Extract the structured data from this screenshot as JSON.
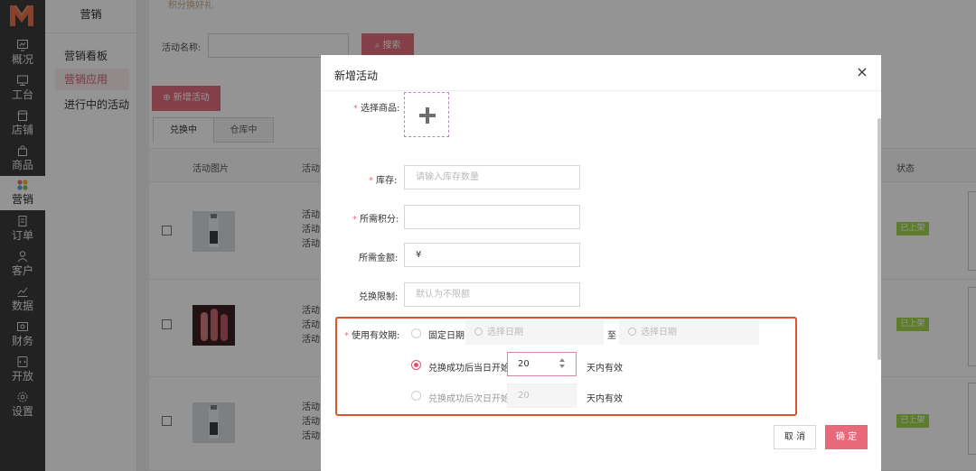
{
  "rail": {
    "items": [
      {
        "label": "概况",
        "icon": "chart-icon"
      },
      {
        "label": "工台",
        "icon": "monitor-icon"
      },
      {
        "label": "店铺",
        "icon": "shop-icon"
      },
      {
        "label": "商品",
        "icon": "bag-icon"
      },
      {
        "label": "营销",
        "icon": "marketing-icon"
      },
      {
        "label": "订单",
        "icon": "order-icon"
      },
      {
        "label": "客户",
        "icon": "user-icon"
      },
      {
        "label": "数据",
        "icon": "data-icon"
      },
      {
        "label": "财务",
        "icon": "finance-icon"
      },
      {
        "label": "开放",
        "icon": "api-icon"
      },
      {
        "label": "设置",
        "icon": "gear-icon"
      }
    ],
    "active": "营销",
    "logo_color": "#e8734e"
  },
  "sidebar": {
    "title": "营销",
    "items": [
      "营销看板",
      "营销应用",
      "进行中的活动"
    ],
    "active": "营销应用"
  },
  "main": {
    "breadcrumb": "积分换好礼",
    "filter": {
      "label": "活动名称:",
      "value": ""
    },
    "search_button": "搜索",
    "add_button": "新增活动",
    "tabs": [
      {
        "label": "兑换中",
        "active": true
      },
      {
        "label": "仓库中",
        "active": false
      }
    ],
    "columns": {
      "image": "活动图片",
      "activity": "活动",
      "status": "状态"
    },
    "rows": [
      {
        "lines": [
          "活动",
          "活动",
          "活动"
        ],
        "status": "已上架"
      },
      {
        "lines": [
          "活动",
          "活动",
          "活动"
        ],
        "status": "已上架"
      },
      {
        "lines": [
          "活动",
          "活动",
          "活动"
        ],
        "status": "已上架"
      }
    ],
    "accent": "#e46e7c"
  },
  "modal": {
    "title": "新增活动",
    "close": "×",
    "fields": {
      "product": {
        "label": "选择商品:",
        "required": true
      },
      "stock": {
        "label": "库存:",
        "required": true,
        "placeholder": "请输入库存数量"
      },
      "points": {
        "label": "所需积分:",
        "required": true,
        "value": ""
      },
      "amount": {
        "label": "所需金额:",
        "required": false,
        "value": "¥"
      },
      "limit": {
        "label": "兑换限制:",
        "required": false,
        "placeholder": "默认为不限额"
      }
    },
    "validity": {
      "label": "使用有效期:",
      "required": true,
      "options": [
        {
          "label": "固定日期",
          "selected": false
        },
        {
          "label": "兑换成功后当日开始",
          "selected": true
        },
        {
          "label": "兑换成功后次日开始",
          "selected": false
        }
      ],
      "date_placeholder": "选择日期",
      "date_separator": "至",
      "same_day_value": "20",
      "next_day_value": "20",
      "days_suffix": "天内有效",
      "highlight_color": "#d9552c"
    },
    "buttons": {
      "cancel": "取 消",
      "ok": "确 定"
    },
    "ok_color": "#e8697a"
  }
}
